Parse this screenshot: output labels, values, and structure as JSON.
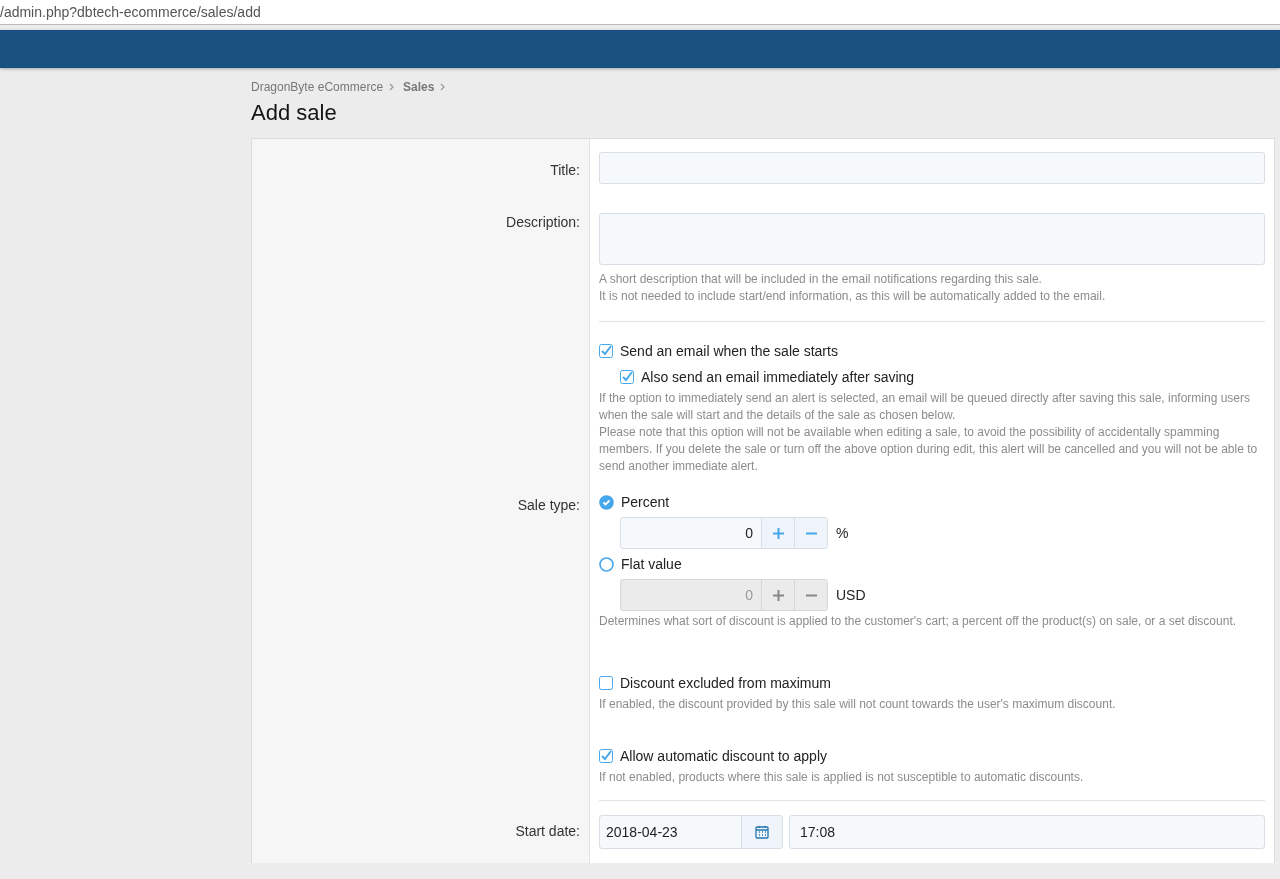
{
  "address_bar": {
    "url": "/admin.php?dbtech-ecommerce/sales/add"
  },
  "breadcrumb": [
    {
      "label": "DragonByte eCommerce",
      "current": false
    },
    {
      "label": "Sales",
      "current": true
    }
  ],
  "page_title": "Add sale",
  "form": {
    "sections": [
      {
        "rows": [
          {
            "kind": "text",
            "label": "Title:"
          },
          {
            "kind": "textarea",
            "label": "Description:",
            "hints": [
              "A short description that will be included in the email notifications regarding this sale.",
              "It is not needed to include start/end information, as this will be automatically added to the email."
            ]
          }
        ]
      },
      {
        "rows": [
          {
            "kind": "checkbox_group",
            "options": [
              {
                "label": "Send an email when the sale starts",
                "checked": true,
                "children": [
                  {
                    "label": "Also send an email immediately after saving",
                    "checked": true
                  }
                ]
              }
            ],
            "hints": [
              "If the option to immediately send an alert is selected, an email will be queued directly after saving this sale, informing users when the sale will start and the details of the sale as chosen below.",
              "Please note that this option will not be available when editing a sale, to avoid the possibility of accidentally spamming members. If you delete the sale or turn off the above option during edit, this alert will be cancelled and you will not be able to send another immediate alert."
            ]
          },
          {
            "kind": "radio_group",
            "label": "Sale type:",
            "options": [
              {
                "label": "Percent",
                "selected": true,
                "value": "0",
                "unit": "%"
              },
              {
                "label": "Flat value",
                "selected": false,
                "value": "0",
                "unit": "USD"
              }
            ],
            "hints": [
              "Determines what sort of discount is applied to the customer's cart; a percent off the product(s) on sale, or a set discount."
            ]
          },
          {
            "kind": "checkbox_group",
            "options": [
              {
                "label": "Discount excluded from maximum",
                "checked": false
              }
            ],
            "hints": [
              "If enabled, the discount provided by this sale will not count towards the user's maximum discount."
            ]
          },
          {
            "kind": "checkbox_group",
            "options": [
              {
                "label": "Allow automatic discount to apply",
                "checked": true
              }
            ],
            "hints": [
              "If not enabled, products where this sale is applied is not susceptible to automatic discounts."
            ]
          }
        ]
      },
      {
        "rows": [
          {
            "kind": "datetime",
            "label": "Start date:",
            "date": "2018-04-23",
            "time": "17:08"
          }
        ]
      }
    ]
  }
}
